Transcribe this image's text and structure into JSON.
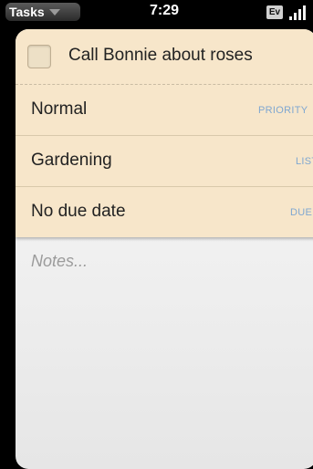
{
  "statusbar": {
    "app_menu_label": "Tasks",
    "time": "7:29",
    "ev_label": "Ev"
  },
  "task": {
    "title": "Call Bonnie about roses",
    "completed": false
  },
  "fields": [
    {
      "value": "Normal",
      "label": "PRIORITY"
    },
    {
      "value": "Gardening",
      "label": "LIST"
    },
    {
      "value": "No due date",
      "label": "DUE"
    }
  ],
  "notes": {
    "placeholder": "Notes..."
  },
  "colors": {
    "header_bg": "#f7e6ca",
    "label_blue": "#7fa7d1"
  }
}
